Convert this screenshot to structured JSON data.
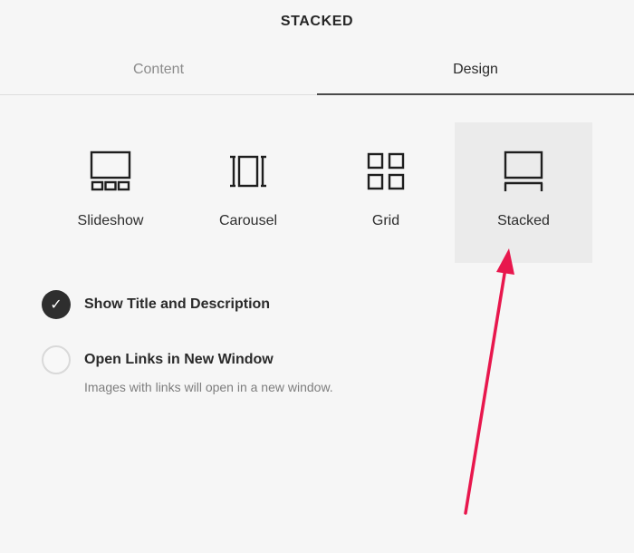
{
  "panel": {
    "title": "STACKED"
  },
  "tabs": [
    {
      "label": "Content",
      "active": false
    },
    {
      "label": "Design",
      "active": true
    }
  ],
  "layouts": [
    {
      "label": "Slideshow",
      "icon": "slideshow-icon",
      "selected": false
    },
    {
      "label": "Carousel",
      "icon": "carousel-icon",
      "selected": false
    },
    {
      "label": "Grid",
      "icon": "grid-icon",
      "selected": false
    },
    {
      "label": "Stacked",
      "icon": "stacked-icon",
      "selected": true
    }
  ],
  "options": [
    {
      "label": "Show Title and Description",
      "checked": true,
      "description": ""
    },
    {
      "label": "Open Links in New Window",
      "checked": false,
      "description": "Images with links will open in a new window."
    }
  ],
  "annotation": {
    "arrow_color": "#e8174d"
  },
  "colors": {
    "background": "#f6f6f6",
    "selected_tile": "#ebebeb",
    "text": "#2a2a2a",
    "muted_text": "#8b8b8b"
  }
}
